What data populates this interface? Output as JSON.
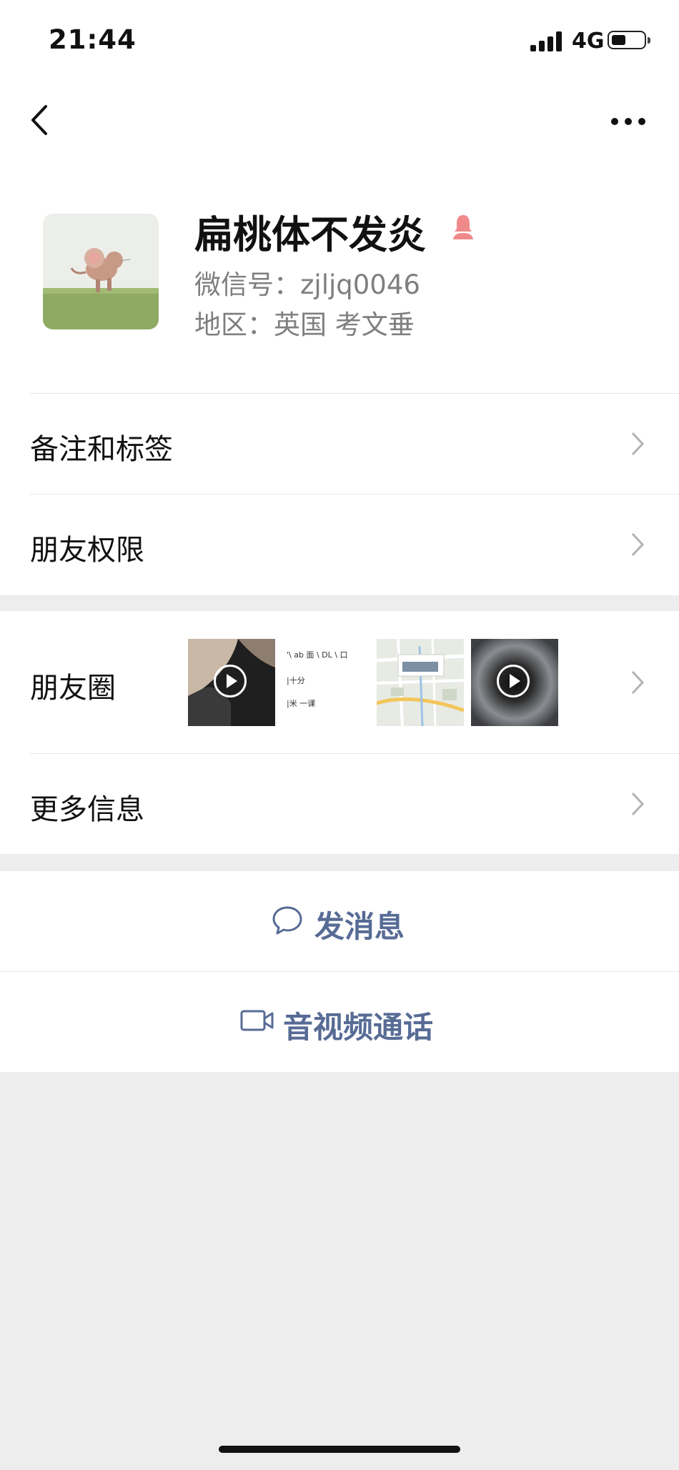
{
  "status_bar": {
    "time": "21:44",
    "network": "4G",
    "battery_level": 0.45
  },
  "profile": {
    "name": "扁桃体不发炎",
    "wechat_id": "微信号：zjljq0046",
    "region": "地区：英国 考文垂",
    "gender_icon": "female-icon",
    "gender_color": "#f08a8a"
  },
  "menu": {
    "notes_tags": "备注和标签",
    "friend_permissions": "朋友权限",
    "moments": "朋友圈",
    "more_info": "更多信息"
  },
  "moments_thumbs": [
    {
      "name": "moment-thumb-video-1",
      "kind": "video"
    },
    {
      "name": "moment-thumb-text",
      "kind": "text",
      "lines": [
        "'\\  ab 面 \\  DL  \\  口",
        "|十分",
        "|米 一课"
      ]
    },
    {
      "name": "moment-thumb-map",
      "kind": "map"
    },
    {
      "name": "moment-thumb-video-2",
      "kind": "video"
    }
  ],
  "actions": {
    "send_message": "发消息",
    "av_call": "音视频通话",
    "accent_color": "#576b95"
  }
}
